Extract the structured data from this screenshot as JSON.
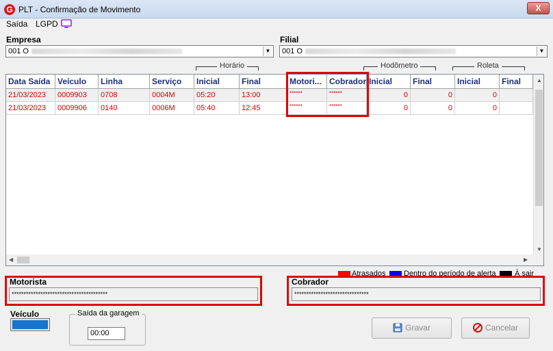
{
  "window": {
    "title": "PLT - Confirmação de Movimento",
    "close_label": "X"
  },
  "menu": [
    {
      "label": "Saída"
    },
    {
      "label": "LGPD"
    }
  ],
  "empresa": {
    "label": "Empresa",
    "value": "001 O"
  },
  "filial": {
    "label": "Filial",
    "value": "001 O"
  },
  "grid": {
    "group_headers": {
      "horario": "Horário",
      "hodometro": "Hodômetro",
      "roleta": "Roleta"
    },
    "columns": [
      "Data Saída",
      "Veículo",
      "Linha",
      "Serviço",
      "Inicial",
      "Final",
      "Motori...",
      "Cobrador",
      "Inicial",
      "Final",
      "Inicial",
      "Final"
    ],
    "rows": [
      [
        "21/03/2023",
        "0009903",
        "0708",
        "0004M",
        "05:20",
        "13:00",
        "******",
        "******",
        "0",
        "0",
        "0",
        ""
      ],
      [
        "21/03/2023",
        "0009906",
        "0140",
        "0006M",
        "05:40",
        "12:45",
        "******",
        "******",
        "0",
        "0",
        "0",
        ""
      ]
    ]
  },
  "legend": {
    "atrasados": "Atrasados",
    "alerta": "Dentro do período de alerta",
    "a_sair": "À sair",
    "colors": {
      "atrasados": "#ff0000",
      "alerta": "#0000ff",
      "a_sair": "#000000"
    }
  },
  "motorista": {
    "label": "Motorista",
    "value": "****************************************"
  },
  "cobrador": {
    "label": "Cobrador",
    "value": "*******************************"
  },
  "veiculo": {
    "label": "Veículo",
    "color": "#1874cd"
  },
  "saida_garagem": {
    "label": "Saída da garagem",
    "value": "00:00"
  },
  "buttons": {
    "gravar": "Gravar",
    "cancelar": "Cancelar"
  }
}
